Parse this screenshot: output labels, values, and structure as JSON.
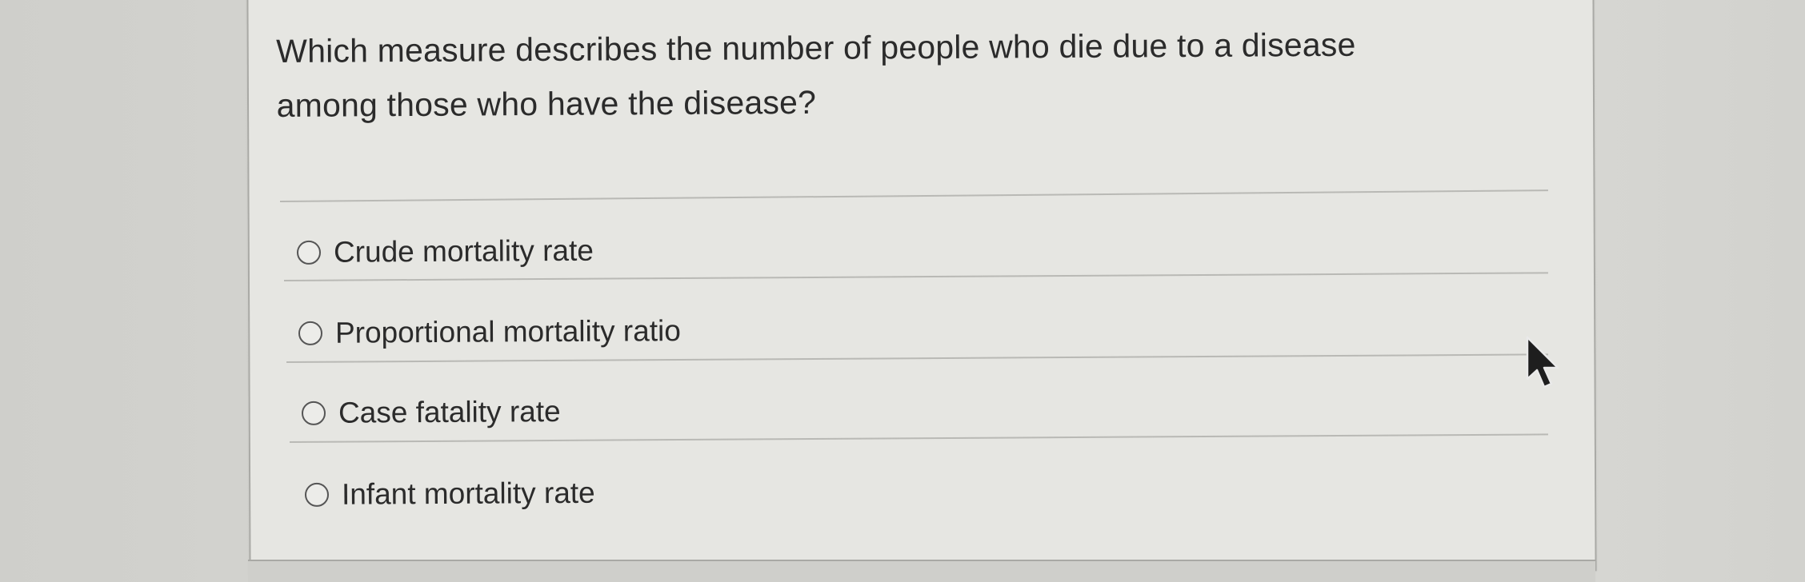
{
  "question": {
    "text_line1": "Which measure describes the number of people who die due to a disease",
    "text_line2": "among those who have the disease?"
  },
  "options": [
    {
      "label": "Crude mortality rate"
    },
    {
      "label": "Proportional mortality ratio"
    },
    {
      "label": "Case fatality rate"
    },
    {
      "label": "Infant mortality rate"
    }
  ],
  "icons": {
    "radio": "radio-unselected-icon",
    "cursor": "mouse-pointer-icon"
  },
  "colors": {
    "background": "#d8d8d4",
    "card": "#e6e6e2",
    "text": "#2b2b2b",
    "divider": "#b9b9b5"
  }
}
